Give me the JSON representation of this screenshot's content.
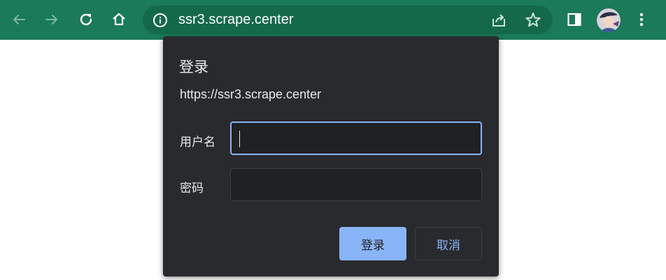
{
  "browser": {
    "url": "ssr3.scrape.center",
    "icons": [
      "back-arrow-icon",
      "forward-arrow-icon",
      "reload-icon",
      "home-icon",
      "site-info-icon",
      "share-icon",
      "bookmark-star-icon",
      "side-panel-icon",
      "profile-avatar",
      "more-menu-icon"
    ],
    "colors": {
      "toolbar": "#1a7a5a",
      "omnibox": "#14694b"
    }
  },
  "auth_dialog": {
    "title": "登录",
    "origin": "https://ssr3.scrape.center",
    "username_label": "用户名",
    "username_value": "",
    "password_label": "密码",
    "password_value": "",
    "sign_in_label": "登录",
    "cancel_label": "取消",
    "colors": {
      "background": "#292a2d",
      "accent": "#8ab4f8",
      "text": "#e8eaed"
    }
  }
}
